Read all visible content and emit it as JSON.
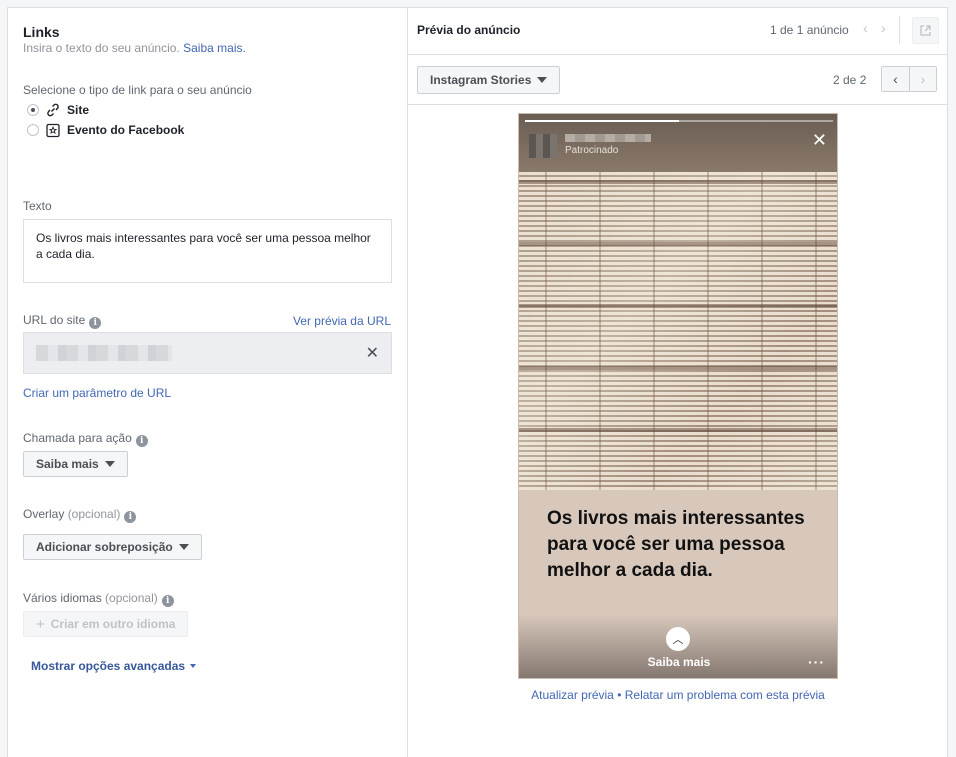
{
  "left": {
    "section_title": "Links",
    "section_subtitle": "Insira o texto do seu anúncio.",
    "learn_more": "Saiba mais.",
    "link_type_label": "Selecione o tipo de link para o seu anúncio",
    "link_types": [
      {
        "label": "Site",
        "selected": true,
        "icon": "link-icon"
      },
      {
        "label": "Evento do Facebook",
        "selected": false,
        "icon": "event-star-icon"
      }
    ],
    "text_label": "Texto",
    "text_value": "Os livros mais interessantes para você ser uma pessoa melhor a cada dia.",
    "url_label": "URL do site",
    "url_preview_link": "Ver prévia da URL",
    "url_param_link": "Criar um parâmetro de URL",
    "cta_label": "Chamada para ação",
    "cta_value": "Saiba mais",
    "overlay_label": "Overlay",
    "overlay_optional": "(opcional)",
    "overlay_button": "Adicionar sobreposição",
    "languages_label": "Vários idiomas",
    "languages_optional": "(opcional)",
    "languages_button": "Criar em outro idioma",
    "advanced_options": "Mostrar opções avançadas"
  },
  "right": {
    "preview_title": "Prévia do anúncio",
    "ad_counter": "1 de 1 anúncio",
    "placement": "Instagram Stories",
    "page_counter": "2 de 2",
    "story": {
      "sponsored": "Patrocinado",
      "caption": "Os livros mais interessantes para você ser uma pessoa melhor a cada dia.",
      "cta": "Saiba mais",
      "progress": 0.5
    },
    "footer_update": "Atualizar prévia",
    "footer_separator": "•",
    "footer_report": "Relatar um problema com esta prévia"
  }
}
